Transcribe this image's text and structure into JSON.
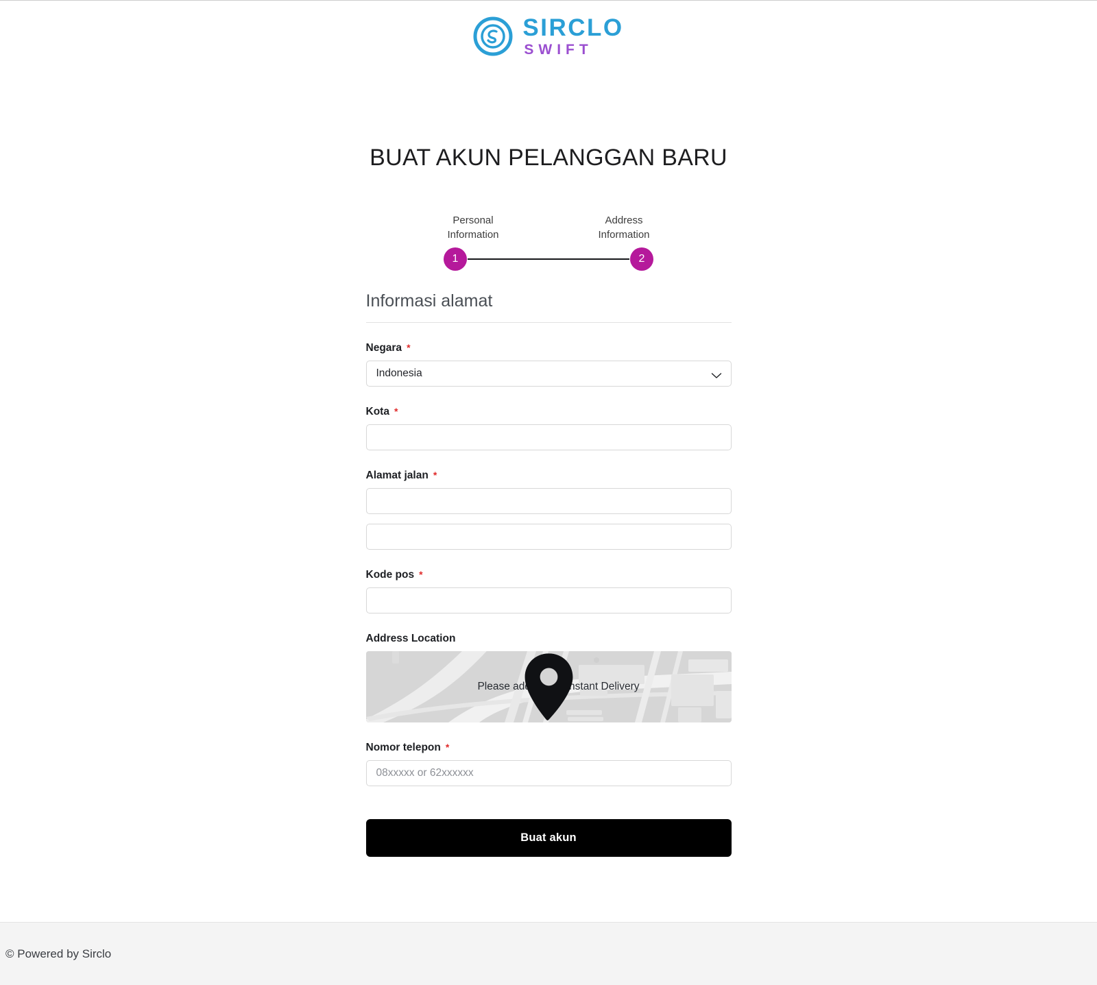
{
  "brand": {
    "name_primary": "SIRCLO",
    "name_secondary": "SWIFT",
    "logo_icon": "sirclo-circle-swirl-icon",
    "color_primary": "#2b9fd6",
    "color_secondary": "#9b4fd0"
  },
  "page": {
    "title": "BUAT AKUN PELANGGAN BARU"
  },
  "stepper": {
    "accent_color": "#b5199b",
    "steps": [
      {
        "number": "1",
        "label": "Personal Information"
      },
      {
        "number": "2",
        "label": "Address Information"
      }
    ]
  },
  "form": {
    "section_heading": "Informasi alamat",
    "required_marker": "*",
    "fields": {
      "country": {
        "label": "Negara",
        "required": true,
        "value": "Indonesia",
        "options": [
          "Indonesia"
        ],
        "chevron_icon": "chevron-down-icon"
      },
      "city": {
        "label": "Kota",
        "required": true,
        "value": "",
        "placeholder": ""
      },
      "street": {
        "label": "Alamat jalan",
        "required": true,
        "value_line1": "",
        "value_line2": "",
        "placeholder": ""
      },
      "postcode": {
        "label": "Kode pos",
        "required": true,
        "value": "",
        "placeholder": ""
      },
      "address_location": {
        "label": "Address Location",
        "required": false,
        "map_message": "Please add pin for Instant Delivery",
        "pin_icon": "map-pin-icon"
      },
      "phone": {
        "label": "Nomor telepon",
        "required": true,
        "value": "",
        "placeholder": "08xxxxx or 62xxxxxx"
      }
    },
    "submit_label": "Buat akun",
    "submit_color": "#000000"
  },
  "footer": {
    "text": "© Powered by Sirclo"
  }
}
